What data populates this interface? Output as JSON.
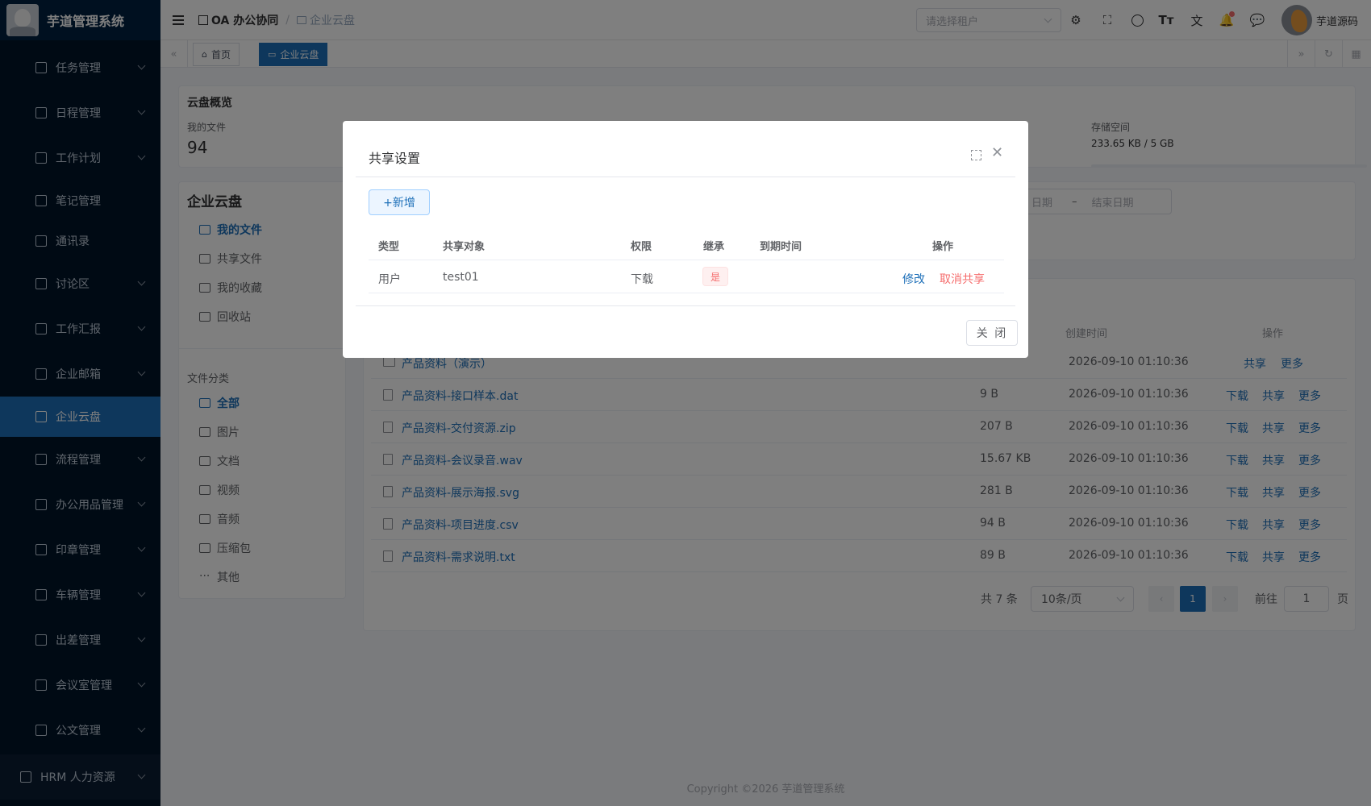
{
  "app": {
    "title": "芋道管理系统"
  },
  "sidebar": {
    "items": [
      {
        "label": "任务管理",
        "icon": "clipboard-icon"
      },
      {
        "label": "日程管理",
        "icon": "calendar-icon"
      },
      {
        "label": "工作计划",
        "icon": "calendar-icon"
      },
      {
        "label": "笔记管理",
        "icon": "notebook-icon"
      },
      {
        "label": "通讯录",
        "icon": "phone-icon"
      },
      {
        "label": "讨论区",
        "icon": "chat-icon"
      },
      {
        "label": "工作汇报",
        "icon": "report-icon"
      },
      {
        "label": "企业邮箱",
        "icon": "mail-icon"
      },
      {
        "label": "企业云盘",
        "icon": "folder-icon"
      },
      {
        "label": "流程管理",
        "icon": "flow-icon"
      },
      {
        "label": "办公用品管理",
        "icon": "bag-icon"
      },
      {
        "label": "印章管理",
        "icon": "stamp-icon"
      },
      {
        "label": "车辆管理",
        "icon": "truck-icon"
      },
      {
        "label": "出差管理",
        "icon": "briefcase-icon"
      },
      {
        "label": "会议室管理",
        "icon": "building-icon"
      },
      {
        "label": "公文管理",
        "icon": "document-icon"
      }
    ],
    "hrm_label": "HRM 人力资源"
  },
  "header": {
    "breadcrumb_root": "OA 办公协同",
    "breadcrumb_current": "企业云盘",
    "tenant_placeholder": "请选择租户",
    "username": "芋道源码"
  },
  "tags": {
    "home": "首页",
    "current": "企业云盘"
  },
  "overview": {
    "title": "云盘概览",
    "my_files_label": "我的文件",
    "my_files_value": "94",
    "storage_label": "存储空间",
    "storage_value": "233.65 KB / 5 GB"
  },
  "side_panel": {
    "title": "企业云盘",
    "items": [
      "我的文件",
      "共享文件",
      "我的收藏",
      "回收站"
    ],
    "category_title": "文件分类",
    "categories": [
      "全部",
      "图片",
      "文档",
      "视频",
      "音频",
      "压缩包",
      "其他"
    ]
  },
  "filter": {
    "date_start": "日期",
    "date_sep": "–",
    "date_end": "结束日期"
  },
  "file_table": {
    "headers": {
      "created": "创建时间",
      "actions": "操作"
    },
    "rows": [
      {
        "name": "产品资料（演示）",
        "size": "",
        "time": "2026-09-10 01:10:36",
        "actions": [
          "共享",
          "更多"
        ]
      },
      {
        "name": "产品资料-接口样本.dat",
        "size": "9 B",
        "time": "2026-09-10 01:10:36",
        "actions": [
          "下载",
          "共享",
          "更多"
        ]
      },
      {
        "name": "产品资料-交付资源.zip",
        "size": "207 B",
        "time": "2026-09-10 01:10:36",
        "actions": [
          "下载",
          "共享",
          "更多"
        ]
      },
      {
        "name": "产品资料-会议录音.wav",
        "size": "15.67 KB",
        "time": "2026-09-10 01:10:36",
        "actions": [
          "下载",
          "共享",
          "更多"
        ]
      },
      {
        "name": "产品资料-展示海报.svg",
        "size": "281 B",
        "time": "2026-09-10 01:10:36",
        "actions": [
          "下载",
          "共享",
          "更多"
        ]
      },
      {
        "name": "产品资料-项目进度.csv",
        "size": "94 B",
        "time": "2026-09-10 01:10:36",
        "actions": [
          "下载",
          "共享",
          "更多"
        ]
      },
      {
        "name": "产品资料-需求说明.txt",
        "size": "89 B",
        "time": "2026-09-10 01:10:36",
        "actions": [
          "下载",
          "共享",
          "更多"
        ]
      }
    ]
  },
  "pagination": {
    "total": "共 7 条",
    "page_size": "10条/页",
    "current": "1",
    "goto_label": "前往",
    "goto_value": "1",
    "page_unit": "页"
  },
  "footer": {
    "copyright": "Copyright ©2026 芋道管理系统"
  },
  "modal": {
    "title": "共享设置",
    "add_button": "+新增",
    "headers": [
      "类型",
      "共享对象",
      "权限",
      "继承",
      "到期时间",
      "操作"
    ],
    "row": {
      "type": "用户",
      "target": "test01",
      "permission": "下载",
      "inherit": "是",
      "expire": "",
      "edit": "修改",
      "cancel": "取消共享"
    },
    "close_button": "关 闭"
  },
  "colors": {
    "primary": "#1d6fb8",
    "danger": "#f56c6c",
    "sidebar_bg": "#001529"
  }
}
